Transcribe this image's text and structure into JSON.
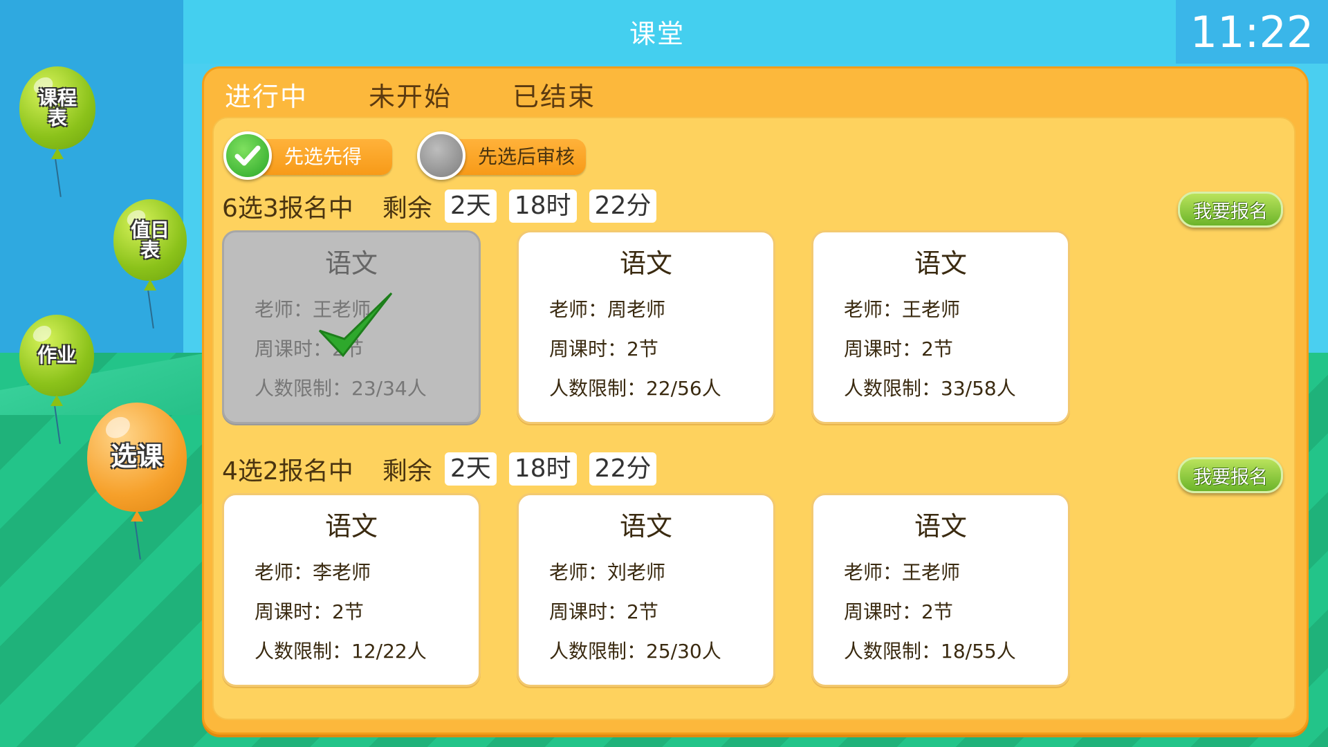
{
  "app": {
    "title": "课堂",
    "time": "11:22"
  },
  "sidebar": {
    "items": [
      {
        "label": "课程表"
      },
      {
        "label": "值日表"
      },
      {
        "label": "作业"
      },
      {
        "label": "选课"
      }
    ]
  },
  "tabs": [
    {
      "label": "进行中",
      "active": true
    },
    {
      "label": "未开始",
      "active": false
    },
    {
      "label": "已结束",
      "active": false
    }
  ],
  "modes": [
    {
      "label": "先选先得",
      "checked": true
    },
    {
      "label": "先选后审核",
      "checked": false
    }
  ],
  "groups": [
    {
      "title": "6选3报名中",
      "remain_label": "剩余",
      "days": "2天",
      "hours": "18时",
      "minutes": "22分",
      "signup_label": "我要报名",
      "courses": [
        {
          "name": "语文",
          "teacher": "老师：王老师",
          "hours": "周课时：2节",
          "limit": "人数限制：23/34人",
          "selected": true
        },
        {
          "name": "语文",
          "teacher": "老师：周老师",
          "hours": "周课时：2节",
          "limit": "人数限制：22/56人",
          "selected": false
        },
        {
          "name": "语文",
          "teacher": "老师：王老师",
          "hours": "周课时：2节",
          "limit": "人数限制：33/58人",
          "selected": false
        }
      ]
    },
    {
      "title": "4选2报名中",
      "remain_label": "剩余",
      "days": "2天",
      "hours": "18时",
      "minutes": "22分",
      "signup_label": "我要报名",
      "courses": [
        {
          "name": "语文",
          "teacher": "老师：李老师",
          "hours": "周课时：2节",
          "limit": "人数限制：12/22人",
          "selected": false
        },
        {
          "name": "语文",
          "teacher": "老师：刘老师",
          "hours": "周课时：2节",
          "limit": "人数限制：25/30人",
          "selected": false
        },
        {
          "name": "语文",
          "teacher": "老师：王老师",
          "hours": "周课时：2节",
          "limit": "人数限制：18/55人",
          "selected": false
        }
      ]
    }
  ]
}
